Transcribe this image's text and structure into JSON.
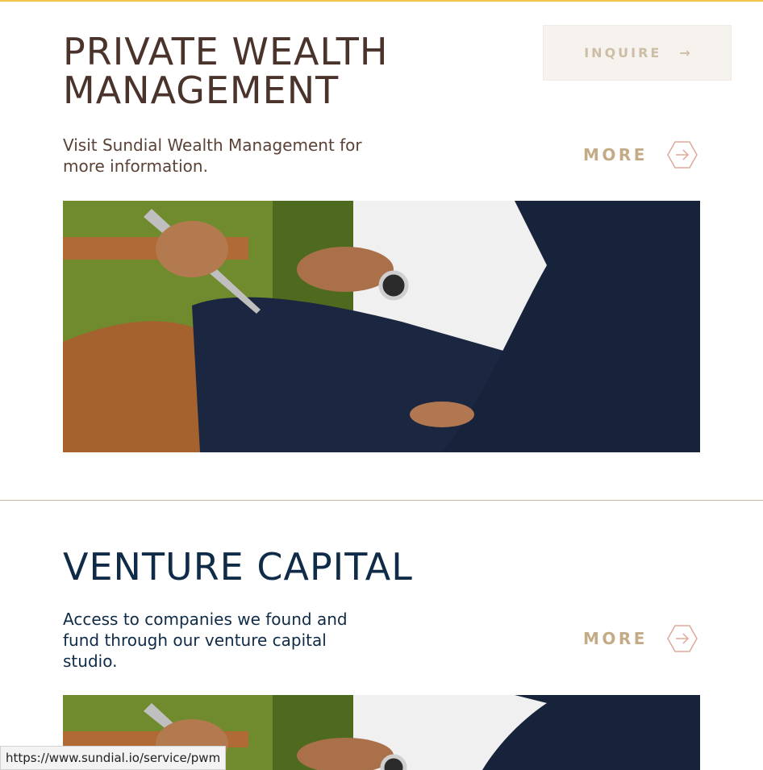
{
  "sections": [
    {
      "title": "PRIVATE WEALTH MANAGEMENT",
      "description": "Visit Sundial Wealth Management for more information.",
      "more_label": "MORE",
      "image_alt": "Two men in business attire seated outdoors, one holding a tablet and wearing a wristwatch"
    },
    {
      "title": "VENTURE CAPITAL",
      "description": "Access to companies we found and fund through our venture capital studio.",
      "more_label": "MORE",
      "image_alt": "Two men in business attire seated outdoors, one holding a tablet and wearing a wristwatch"
    }
  ],
  "header": {
    "inquire_label": "INQUIRE",
    "inquire_arrow": "→"
  },
  "status_bar": {
    "url": "https://www.sundial.io/service/pwm"
  },
  "colors": {
    "accent_top_line": "#f3c64a",
    "pwm_text": "#4a332b",
    "vc_text": "#0f2b47",
    "more_gold": "#c4ab86",
    "hex_icon": "#e0a89a"
  },
  "icons": {
    "inquire_arrow": "arrow-right-icon",
    "more_icon": "hexagon-arrow-right-icon"
  }
}
